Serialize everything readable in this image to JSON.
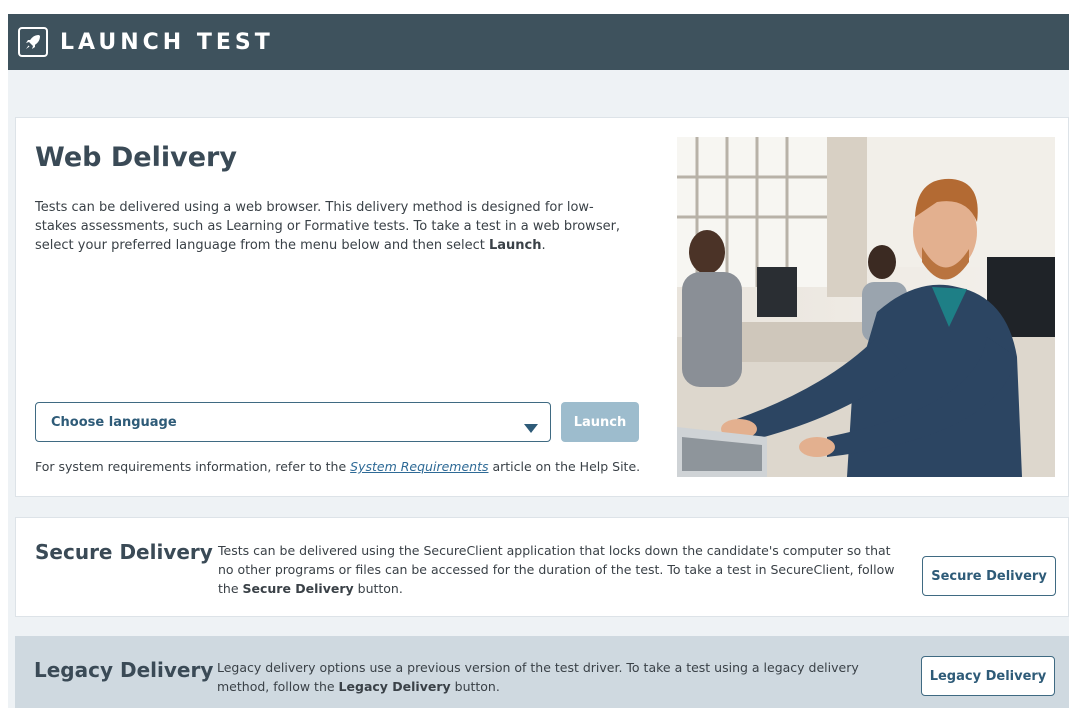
{
  "header": {
    "title": "LAUNCH TEST",
    "icon": "rocket-icon"
  },
  "web": {
    "title": "Web Delivery",
    "desc_part1": "Tests can be delivered using a web browser. This delivery method is designed for low-stakes assessments, such as Learning or Formative tests. To take a test in a web browser, select your preferred language from the menu below and then select ",
    "desc_bold": "Launch",
    "desc_end": ".",
    "select_label": "Choose language",
    "launch_label": "Launch",
    "sysreq_before": "For system requirements information, refer to the ",
    "sysreq_link": "System Requirements",
    "sysreq_after": " article on the Help Site."
  },
  "secure": {
    "title": "Secure Delivery",
    "desc_part1": "Tests can be delivered using the SecureClient application that locks down the candidate's computer so that no other programs or files can be accessed for the duration of the test. To take a test in SecureClient, follow the ",
    "desc_bold": "Secure Delivery",
    "desc_end": " button.",
    "button_label": "Secure Delivery"
  },
  "legacy": {
    "title": "Legacy Delivery",
    "desc_part1": "Legacy delivery options use a previous version of the test driver. To take a test using a legacy delivery method, follow the ",
    "desc_bold": "Legacy Delivery",
    "desc_end": " button.",
    "button_label": "Legacy Delivery"
  },
  "colors": {
    "header_bg": "#3e525d",
    "accent": "#2e5b78",
    "launch_disabled": "#9dbccd",
    "legacy_bg": "#cfd9e0"
  }
}
